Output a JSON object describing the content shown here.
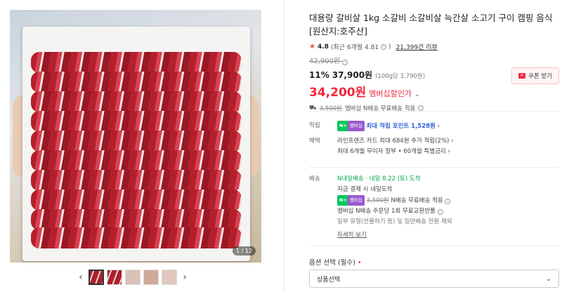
{
  "gallery": {
    "counter": "1 / 12",
    "prev": "‹",
    "next": "›",
    "thumb_count": 5
  },
  "product": {
    "title": "대용량 갈비살 1kg 소갈비 소갈비살 늑간살 소고기 구이 캠핑 음식 [원산지:호주산]",
    "rating": "4.8",
    "rating_recent": "(최근 6개월 4.81",
    "reviews": "21,399건 리뷰",
    "original_price": "42,900원",
    "discount": "11%",
    "sale_price": "37,900원",
    "unit_price": "(100g당 3,790원)",
    "member_price": "34,200원",
    "member_label": "멤버십할인가",
    "coupon_label": "쿠폰 받기",
    "ship_orig": "3,500원",
    "ship_text": "멤버십 N배송 무료배송 적용"
  },
  "rows": {
    "points": {
      "key": "적립",
      "badge": "N+",
      "mbadge": "멤버십",
      "text": "최대 적립 포인트 1,528원"
    },
    "benefit": {
      "key": "혜택",
      "line1": "라인프렌즈 카드 최대 684원 추가 적립(2%)",
      "line2": "최대 6개월 무이자 할부 • 60개월 특별금리"
    },
    "delivery": {
      "key": "배송",
      "n_label": "N내일배송",
      "date": "· 내일 8.22 (토) 도착",
      "line2": "지금 결제 시 내일도착",
      "ship_orig": "3,500원",
      "ship_free": "N배송 무료배송 적용",
      "line4": "멤버십 N배송 주문당 1회 무료교환반품",
      "line5": "일부 유형(선물하기 등) 및 일반배송 전환 제외",
      "more": "자세히 보기"
    }
  },
  "option": {
    "label": "옵션 선택 (필수)",
    "required_mark": "•",
    "select_value": "상품선택"
  }
}
